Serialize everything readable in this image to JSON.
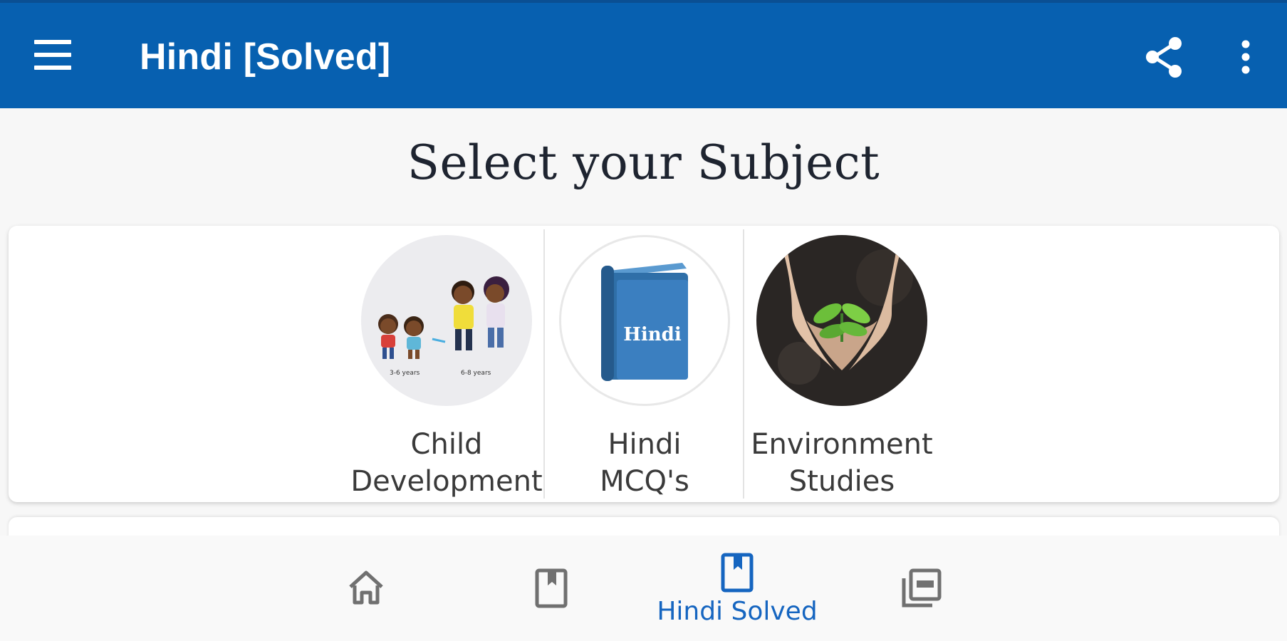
{
  "appbar": {
    "title": "Hindi [Solved]",
    "menu_icon": "hamburger-menu-icon",
    "share_icon": "share-icon",
    "more_icon": "more-vert-icon"
  },
  "heading": "Select your Subject",
  "subjects": [
    {
      "label_line1": "Child",
      "label_line2": "Development",
      "icon": "children-illustration",
      "caption_left": "3-6 years",
      "caption_right": "6-8 years"
    },
    {
      "label_line1": "Hindi",
      "label_line2": "MCQ's",
      "icon": "book-icon",
      "book_text": "Hindi"
    },
    {
      "label_line1": "Environment",
      "label_line2": "Studies",
      "icon": "plant-in-hands-photo"
    }
  ],
  "bottom_nav": {
    "items": [
      {
        "name": "home",
        "icon": "home-icon",
        "label": ""
      },
      {
        "name": "bookmark",
        "icon": "bookmark-book-icon",
        "label": ""
      },
      {
        "name": "hindi-solved",
        "icon": "bookmark-book-icon",
        "label": "Hindi Solved",
        "active": true
      },
      {
        "name": "pdf",
        "icon": "pdf-stack-icon",
        "label": ""
      }
    ]
  },
  "colors": {
    "appbar": "#0760b0",
    "active_nav": "#1565c0",
    "inactive_nav": "#707070",
    "background": "#f7f7f7"
  }
}
